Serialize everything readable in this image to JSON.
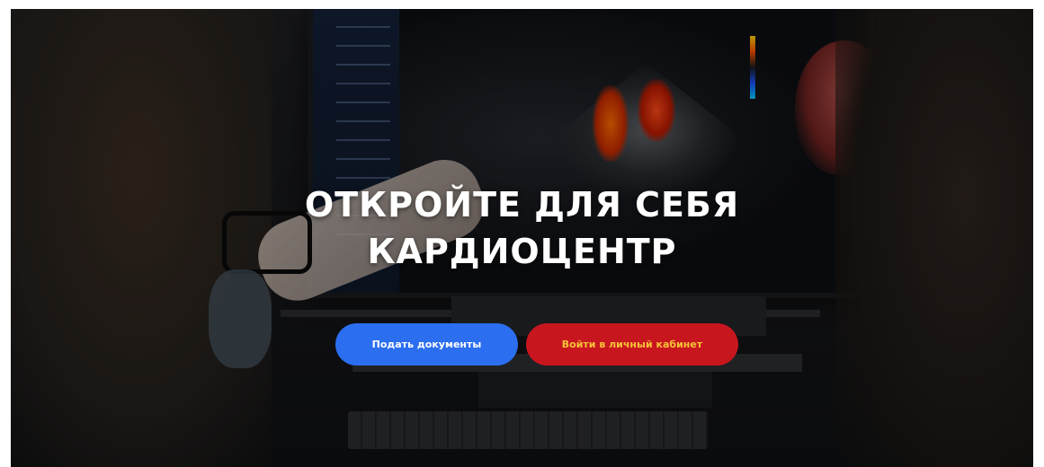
{
  "hero": {
    "title_line1": "ОТКРОЙТЕ ДЛЯ СЕБЯ",
    "title_line2": "КАРДИОЦЕНТР",
    "background_image": "doctors-viewing-cardiac-ultrasound-monitor"
  },
  "buttons": {
    "submit_docs_label": "Подать документы",
    "login_label": "Войти в личный кабинет"
  },
  "colors": {
    "blue_button": "#2b6ef0",
    "red_button": "#c8161f",
    "red_button_text": "#f6c238",
    "title_text": "#ffffff"
  }
}
